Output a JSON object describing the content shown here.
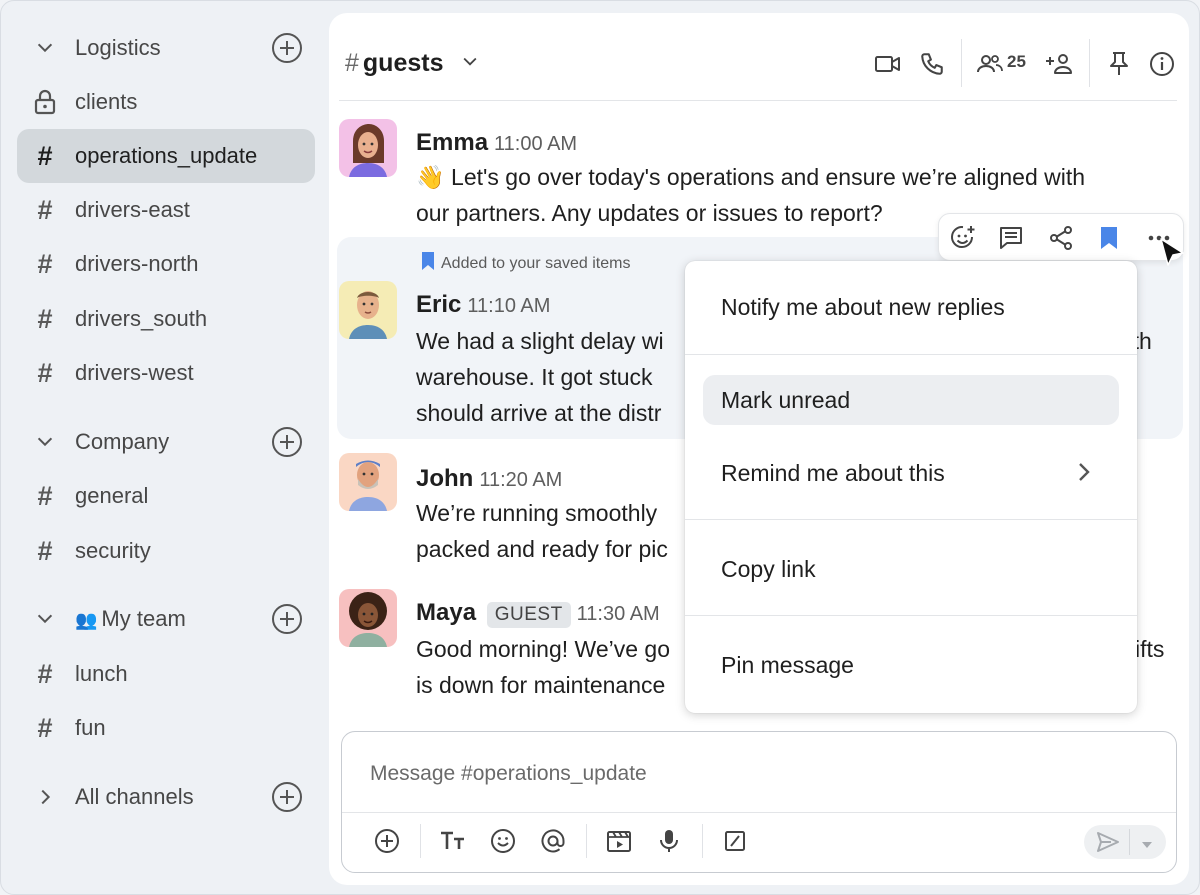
{
  "sidebar": {
    "sections": [
      {
        "label": "Logistics"
      },
      {
        "label": "Company"
      },
      {
        "label": "My team",
        "emoji": "👥"
      },
      {
        "label": "All channels"
      }
    ],
    "channels": {
      "clients": "clients",
      "operations_update": "operations_update",
      "drivers_east": "drivers-east",
      "drivers_north": "drivers-north",
      "drivers_south": "drivers_south",
      "drivers_west": "drivers-west",
      "general": "general",
      "security": "security",
      "lunch": "lunch",
      "fun": "fun"
    },
    "selected": "operations_update",
    "hash": "#"
  },
  "header": {
    "hash": "#",
    "channel_name": "guests",
    "member_count": "25"
  },
  "messages": [
    {
      "sender": "Emma",
      "time": "11:00 AM",
      "line1": "👋 Let's go over today's operations and ensure we’re aligned with",
      "line2": "our partners. Any updates or issues to report?"
    },
    {
      "sender": "Eric",
      "time": "11:10 AM",
      "saved_note": "Added to your saved items",
      "line1": "We had a slight delay wi",
      "line1_tail": "rth",
      "line2": "warehouse. It got stuck",
      "line3": "should arrive at the distr"
    },
    {
      "sender": "John",
      "time": "11:20 AM",
      "line1": "We’re running smoothly",
      "line2": "packed and ready for pic"
    },
    {
      "sender": "Maya",
      "badge": "GUEST",
      "time": "11:30 AM",
      "line1": "Good morning! We’ve go",
      "line1_tail": "ifts",
      "line2": "is down for maintenance"
    }
  ],
  "context_menu": {
    "items": [
      "Notify me about new replies",
      "Mark unread",
      "Remind me about this",
      "Copy link",
      "Pin message"
    ]
  },
  "composer": {
    "placeholder": "Message #operations_update"
  },
  "colors": {
    "accent_blue": "#4a86e8",
    "selected_row": "#d3d8dc",
    "highlight_message": "#f1f4f8"
  }
}
